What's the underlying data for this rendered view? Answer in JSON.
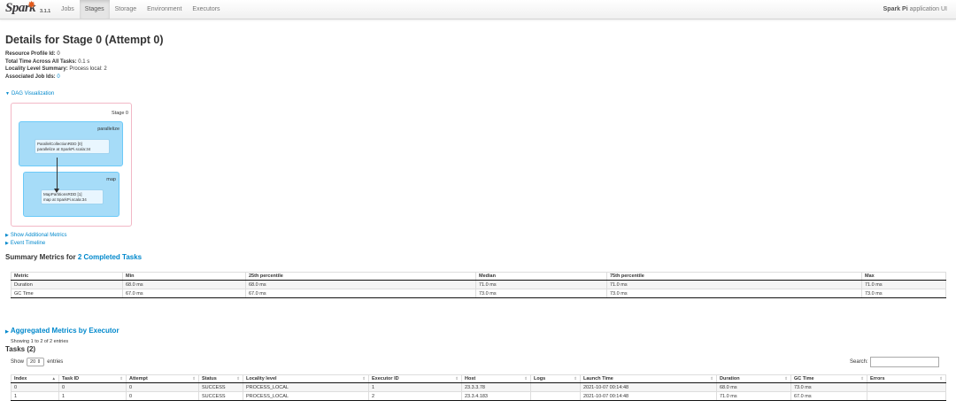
{
  "nav": {
    "logo_text": "Spark",
    "version": "3.1.1",
    "tabs": [
      {
        "label": "Jobs",
        "active": false
      },
      {
        "label": "Stages",
        "active": true
      },
      {
        "label": "Storage",
        "active": false
      },
      {
        "label": "Environment",
        "active": false
      },
      {
        "label": "Executors",
        "active": false
      }
    ],
    "app_name_bold": "Spark Pi",
    "app_name_suffix": " application UI"
  },
  "page": {
    "title": "Details for Stage 0 (Attempt 0)",
    "summary": [
      {
        "label": "Resource Profile Id:",
        "value": " 0"
      },
      {
        "label": "Total Time Across All Tasks:",
        "value": " 0.1 s"
      },
      {
        "label": "Locality Level Summary:",
        "value": " Process local: 2"
      },
      {
        "label": "Associated Job Ids:",
        "value": "0"
      }
    ]
  },
  "dag": {
    "toggle_label": "DAG Visualization",
    "stage_label": "Stage 0",
    "clusters": [
      {
        "label": "parallelize",
        "node_line1": "ParallelCollectionRDD [0]",
        "node_line2": "parallelize at SparkPi.scala:34"
      },
      {
        "label": "map",
        "node_line1": "MapPartitionsRDD [1]",
        "node_line2": "map at SparkPi.scala:34"
      }
    ]
  },
  "links": {
    "additional_metrics": "Show Additional Metrics",
    "event_timeline": "Event Timeline"
  },
  "summary_metrics": {
    "title_prefix": "Summary Metrics for ",
    "title_link": "2 Completed Tasks",
    "headers": [
      "Metric",
      "Min",
      "25th percentile",
      "Median",
      "75th percentile",
      "Max"
    ],
    "rows": [
      [
        "Duration",
        "68.0 ms",
        "68.0 ms",
        "71.0 ms",
        "71.0 ms",
        "71.0 ms"
      ],
      [
        "GC Time",
        "67.0 ms",
        "67.0 ms",
        "73.0 ms",
        "73.0 ms",
        "73.0 ms"
      ]
    ],
    "entries_text": "Showing 1 to 2 of 2 entries"
  },
  "aggregated": {
    "label": "Aggregated Metrics by Executor"
  },
  "tasks": {
    "title": "Tasks (2)",
    "show_label": "Show",
    "page_size": "20",
    "entries_label": "entries",
    "search_label": "Search:",
    "headers": [
      "Index",
      "Task ID",
      "Attempt",
      "Status",
      "Locality level",
      "Executor ID",
      "Host",
      "Logs",
      "Launch Time",
      "Duration",
      "GC Time",
      "Errors"
    ],
    "rows": [
      [
        "0",
        "0",
        "0",
        "SUCCESS",
        "PROCESS_LOCAL",
        "1",
        "23.3.3.78",
        "",
        "2021-10-07 00:14:48",
        "68.0 ms",
        "73.0 ms",
        ""
      ],
      [
        "1",
        "1",
        "0",
        "SUCCESS",
        "PROCESS_LOCAL",
        "2",
        "23.3.4.183",
        "",
        "2021-10-07 00:14:48",
        "71.0 ms",
        "67.0 ms",
        ""
      ]
    ]
  }
}
